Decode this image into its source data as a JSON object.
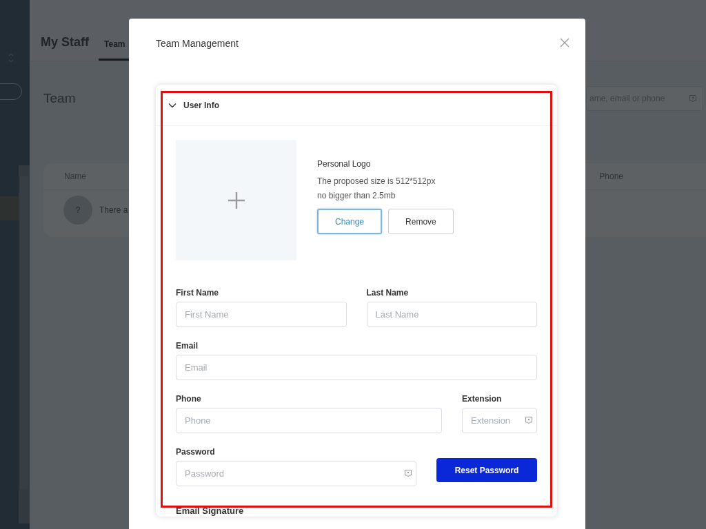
{
  "page": {
    "title": "My Staff",
    "tabs": [
      {
        "label": "Team",
        "selected": true
      }
    ],
    "heading": "Team",
    "search": {
      "placeholder": "ame, email or phone"
    },
    "table": {
      "columns": [
        "Name",
        "Phone"
      ],
      "rows": [
        {
          "avatar": "?",
          "text": "There a"
        }
      ]
    }
  },
  "modal": {
    "title": "Team Management",
    "section": {
      "title": "User Info",
      "expanded": true,
      "logo": {
        "title": "Personal Logo",
        "hint_lines": [
          "The proposed size is 512*512px",
          "no bigger than 2.5mb"
        ],
        "buttons": [
          {
            "label": "Change",
            "kind": "outline"
          },
          {
            "label": "Remove",
            "kind": "default"
          }
        ]
      },
      "rows": [
        [
          {
            "kind": "input",
            "label": "First Name",
            "placeholder": "First Name"
          },
          {
            "kind": "input",
            "label": "Last Name",
            "placeholder": "Last Name"
          }
        ],
        [
          {
            "kind": "input",
            "label": "Email",
            "placeholder": "Email"
          }
        ],
        [
          {
            "kind": "input",
            "label": "Phone",
            "placeholder": "Phone"
          },
          {
            "kind": "compact",
            "label": "Extension",
            "placeholder": "Extension"
          }
        ],
        [
          {
            "kind": "secret",
            "label": "Password",
            "placeholder": "Password"
          },
          {
            "kind": "button",
            "label": "Reset Password"
          }
        ]
      ]
    },
    "next_section_label": "Email Signature"
  }
}
